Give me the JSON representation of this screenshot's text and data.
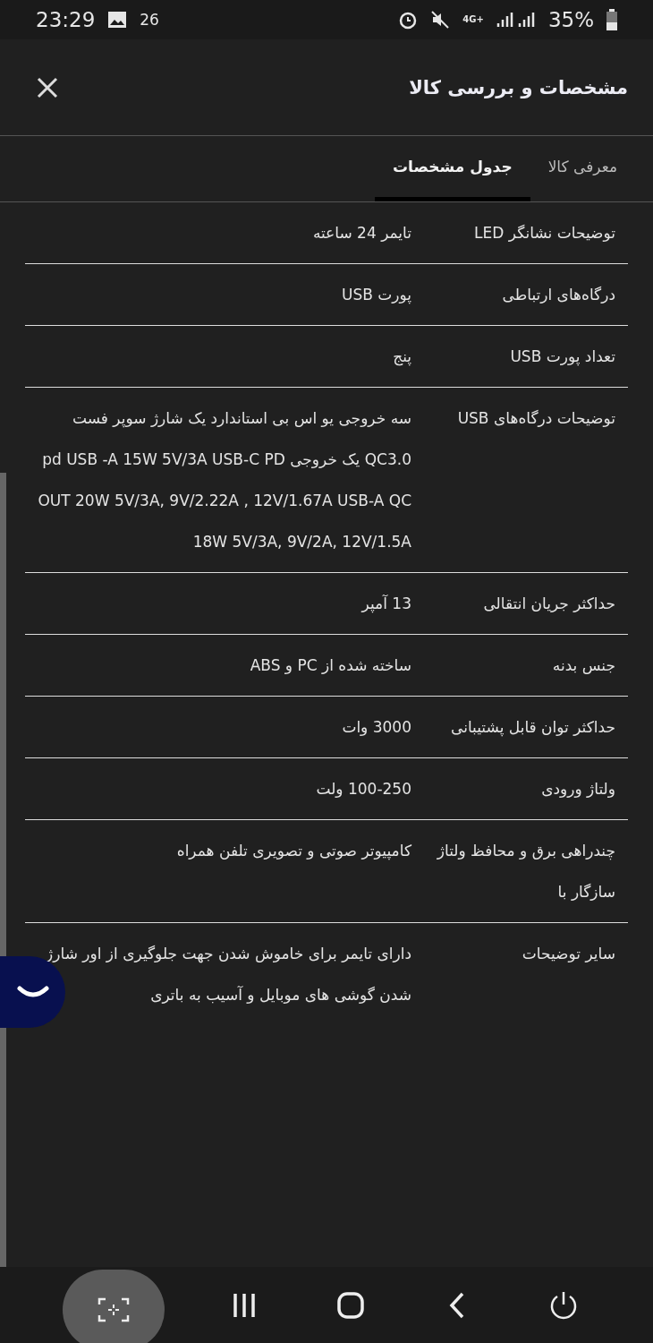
{
  "status_bar": {
    "time": "23:29",
    "notification_count": "26",
    "network": "4G+",
    "battery": "35%"
  },
  "header": {
    "title": "مشخصات و بررسی کالا"
  },
  "tabs": [
    {
      "label": "معرفی کالا",
      "selected": false
    },
    {
      "label": "جدول مشخصات",
      "selected": true
    }
  ],
  "specs": [
    {
      "label": "توضیحات نشانگر LED",
      "value": "تایمر 24 ساعته"
    },
    {
      "label": "درگاه‌های ارتباطی",
      "value": "پورت USB"
    },
    {
      "label": "تعداد پورت USB",
      "value": "پنج"
    },
    {
      "label": "توضیحات درگاه‌های USB",
      "value": "سه خروجی یو اس بی استاندارد یک شارژ سوپر فست QC3.0 یک خروجی pd USB -A 15W 5V/3A USB-C PD OUT 20W 5V/3A, 9V/2.22A , 12V/1.67A USB-A QC 18W 5V/3A, 9V/2A, 12V/1.5A"
    },
    {
      "label": "حداکثر جریان انتقالی",
      "value": "13 آمپر"
    },
    {
      "label": "جنس بدنه",
      "value": "ساخته شده از PC و ABS"
    },
    {
      "label": "حداکثر توان قابل پشتیبانی",
      "value": "3000 وات"
    },
    {
      "label": "ولتاژ ورودی",
      "value": "100-250 ولت"
    },
    {
      "label": "چندراهی برق و محافظ ولتاژ سازگار با",
      "value": "کامپیوتر صوتی و تصویری تلفن همراه"
    },
    {
      "label": "سایر توضیحات",
      "value": "دارای تایمر برای خاموش شدن جهت جلوگیری از اور شارژ شدن گوشی های موبایل و آسیب به باتری"
    }
  ]
}
